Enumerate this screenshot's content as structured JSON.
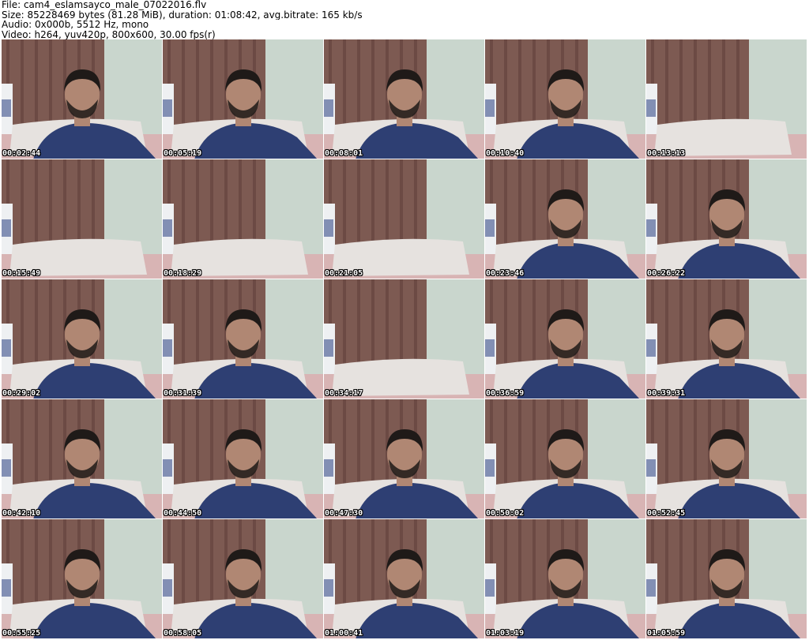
{
  "header": {
    "file": "File: cam4_eslamsayco_male_07022016.flv",
    "size": "Size: 85228469 bytes (81.28 MiB), duration: 01:08:42, avg.bitrate: 165 kb/s",
    "audio": "Audio: 0x000b, 5512 Hz, mono",
    "video": "Video: h264, yuv420p, 800x600, 30.00 fps(r)"
  },
  "thumbnails": [
    {
      "timestamp": "00:02:44",
      "person": true
    },
    {
      "timestamp": "00:05:19",
      "person": true
    },
    {
      "timestamp": "00:08:01",
      "person": true
    },
    {
      "timestamp": "00:10:40",
      "person": true
    },
    {
      "timestamp": "00:13:13",
      "person": false
    },
    {
      "timestamp": "00:15:49",
      "person": false
    },
    {
      "timestamp": "00:18:29",
      "person": false
    },
    {
      "timestamp": "00:21:05",
      "person": false
    },
    {
      "timestamp": "00:23:46",
      "person": true
    },
    {
      "timestamp": "00:26:22",
      "person": true
    },
    {
      "timestamp": "00:29:02",
      "person": true
    },
    {
      "timestamp": "00:31:39",
      "person": true
    },
    {
      "timestamp": "00:34:17",
      "person": false
    },
    {
      "timestamp": "00:36:59",
      "person": true
    },
    {
      "timestamp": "00:39:31",
      "person": true
    },
    {
      "timestamp": "00:42:10",
      "person": true
    },
    {
      "timestamp": "00:44:50",
      "person": true
    },
    {
      "timestamp": "00:47:30",
      "person": true
    },
    {
      "timestamp": "00:50:02",
      "person": true
    },
    {
      "timestamp": "00:52:45",
      "person": true
    },
    {
      "timestamp": "00:55:25",
      "person": true
    },
    {
      "timestamp": "00:58:05",
      "person": true
    },
    {
      "timestamp": "01:00:41",
      "person": true
    },
    {
      "timestamp": "01:03:19",
      "person": true
    },
    {
      "timestamp": "01:05:59",
      "person": true
    }
  ],
  "colors": {
    "wall": "#c9d6cd",
    "curtain": "#7d5a52",
    "curtain_dark": "#5e3e38",
    "pillow": "#e6e2df",
    "bedsheet": "#d8b4b4",
    "shirt": "#2e3f73",
    "skin": "#b08773",
    "hair": "#1f1a18",
    "bottle": "#eef0f2",
    "bottle_label": "#3a4f8a"
  }
}
